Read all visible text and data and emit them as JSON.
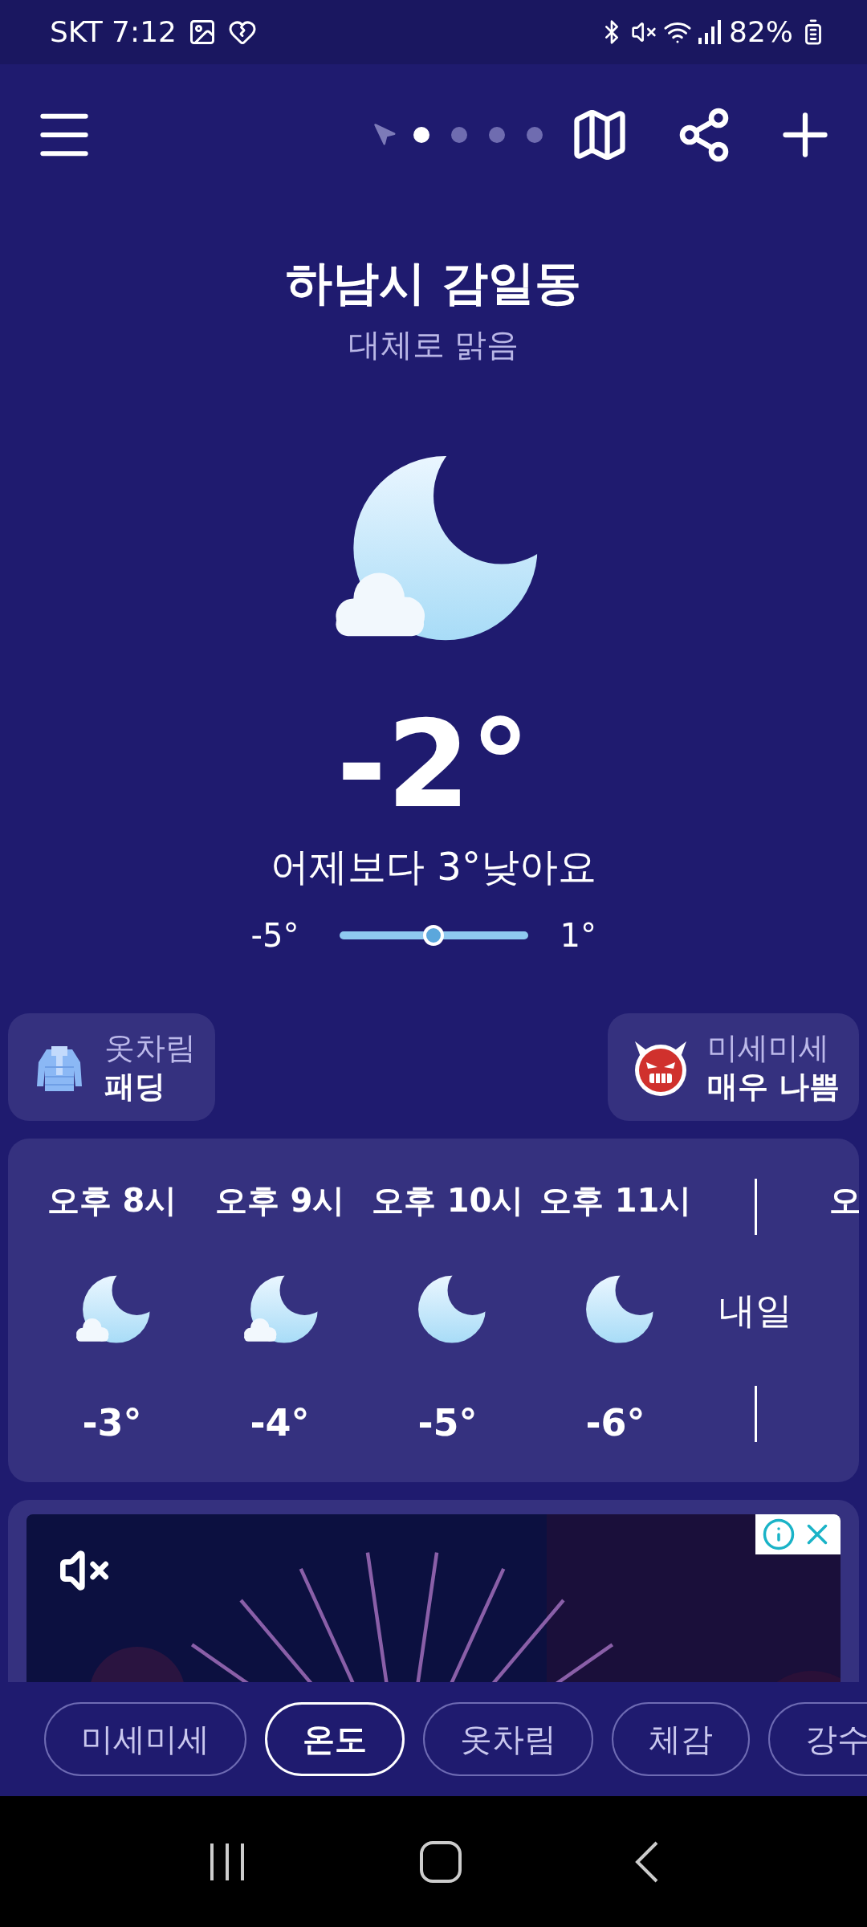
{
  "status_bar": {
    "carrier_time": "SKT 7:12",
    "battery": "82%"
  },
  "page_dots": [
    {
      "selected": true
    },
    {
      "selected": false
    },
    {
      "selected": false
    },
    {
      "selected": false
    }
  ],
  "location": {
    "name": "하남시 감일동",
    "condition": "대체로 맑음"
  },
  "current": {
    "kind": "moon_cloud",
    "temperature": "-2°",
    "comparison": "어제보다 3°낮아요",
    "low": "-5°",
    "high": "1°",
    "level": 0.5
  },
  "info_cards": [
    {
      "kind": "clothing",
      "label": "옷차림",
      "value": "패딩"
    },
    {
      "kind": "dust",
      "label": "미세미세",
      "value": "매우 나쁨"
    }
  ],
  "hourly": [
    {
      "kind": "moon_cloud",
      "time": "오후 8시",
      "temp": "-3°"
    },
    {
      "kind": "moon_cloud",
      "time": "오후 9시",
      "temp": "-4°"
    },
    {
      "kind": "moon",
      "time": "오후 10시",
      "temp": "-5°"
    },
    {
      "kind": "moon",
      "time": "오후 11시",
      "temp": "-6°"
    },
    {
      "kind": "day_break",
      "label": "내일"
    },
    {
      "kind": "partial",
      "time": "오"
    }
  ],
  "tabs": [
    {
      "label": "미세미세",
      "selected": false
    },
    {
      "label": "온도",
      "selected": true
    },
    {
      "label": "옷차림",
      "selected": false
    },
    {
      "label": "체감",
      "selected": false
    },
    {
      "label": "강수",
      "selected": false
    }
  ]
}
